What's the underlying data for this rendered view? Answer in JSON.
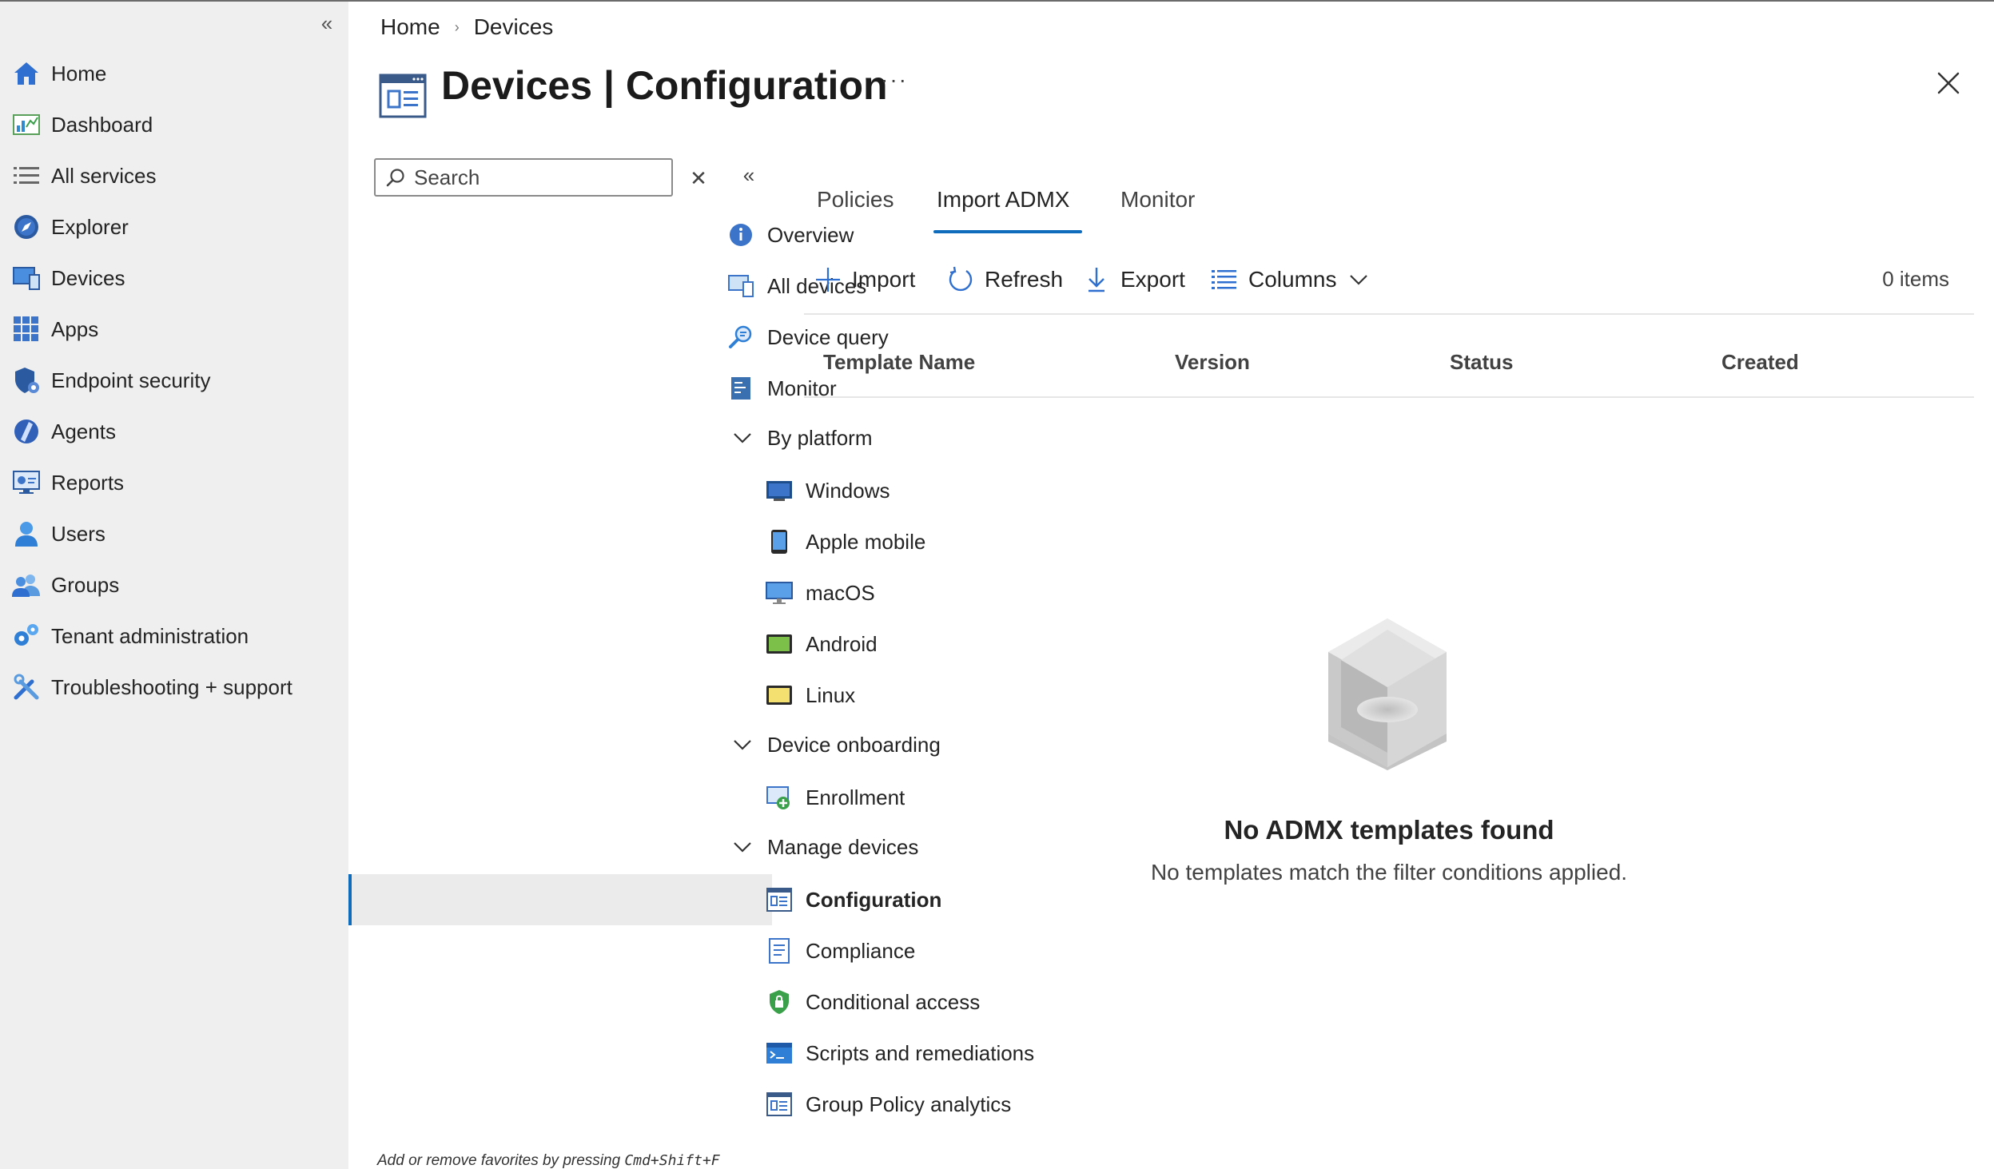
{
  "global_nav": {
    "collapse_label": "«",
    "items": [
      {
        "label": "Home",
        "icon": "home-icon"
      },
      {
        "label": "Dashboard",
        "icon": "dashboard-icon"
      },
      {
        "label": "All services",
        "icon": "list-icon"
      },
      {
        "label": "Explorer",
        "icon": "explorer-icon"
      },
      {
        "label": "Devices",
        "icon": "devices-icon"
      },
      {
        "label": "Apps",
        "icon": "apps-grid-icon"
      },
      {
        "label": "Endpoint security",
        "icon": "shield-icon"
      },
      {
        "label": "Agents",
        "icon": "agents-icon"
      },
      {
        "label": "Reports",
        "icon": "reports-icon"
      },
      {
        "label": "Users",
        "icon": "user-icon"
      },
      {
        "label": "Groups",
        "icon": "groups-icon"
      },
      {
        "label": "Tenant administration",
        "icon": "tenant-admin-icon"
      },
      {
        "label": "Troubleshooting + support",
        "icon": "wrench-icon"
      }
    ]
  },
  "breadcrumb": {
    "home": "Home",
    "separator": "›",
    "current": "Devices"
  },
  "header": {
    "title_bold": "Devices",
    "title_rest": " | Configuration",
    "more": "···"
  },
  "search": {
    "placeholder": "Search",
    "clear": "✕",
    "collapse": "«"
  },
  "section_nav": {
    "overview": "Overview",
    "all_devices": "All devices",
    "device_query": "Device query",
    "monitor": "Monitor",
    "by_platform": "By platform",
    "windows": "Windows",
    "apple_mobile": "Apple mobile",
    "macos": "macOS",
    "android": "Android",
    "linux": "Linux",
    "device_onboarding": "Device onboarding",
    "enrollment": "Enrollment",
    "manage_devices": "Manage devices",
    "configuration": "Configuration",
    "compliance": "Compliance",
    "conditional_access": "Conditional access",
    "scripts": "Scripts and remediations",
    "gpa": "Group Policy analytics"
  },
  "favorites_hint": {
    "text": "Add or remove favorites by pressing ",
    "shortcut": "Cmd+Shift+F"
  },
  "tabs": {
    "policies": "Policies",
    "import_admx": "Import ADMX",
    "monitor": "Monitor"
  },
  "toolbar": {
    "import": "Import",
    "refresh": "Refresh",
    "export": "Export",
    "columns": "Columns",
    "items": "0 items"
  },
  "table": {
    "columns": [
      "Template Name",
      "Version",
      "Status",
      "Created"
    ]
  },
  "empty_state": {
    "title": "No ADMX templates found",
    "subtitle": "No templates match the filter conditions applied."
  },
  "colors": {
    "accent": "#0f6cbd",
    "nav_bg": "#efefef",
    "selected_bg": "#ebebeb"
  }
}
